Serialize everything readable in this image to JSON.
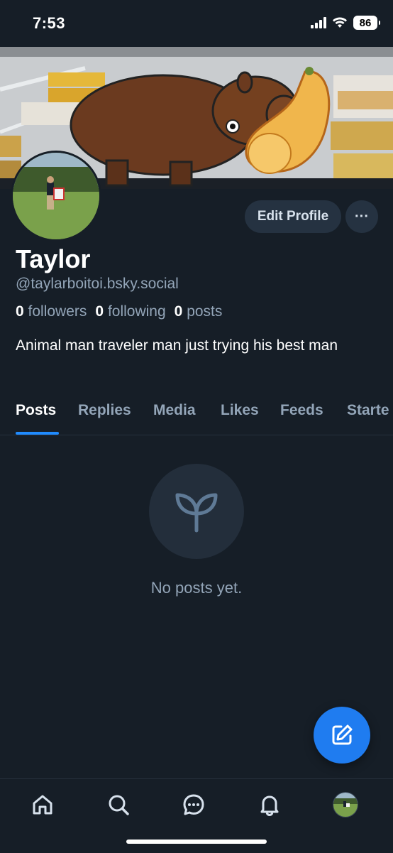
{
  "status_bar": {
    "time": "7:53",
    "battery": "86",
    "icons": [
      "signal-icon",
      "wifi-icon",
      "battery-icon"
    ]
  },
  "profile": {
    "display_name": "Taylor",
    "handle": "@taylarboitoi.bsky.social",
    "followers_count": "0",
    "followers_label": "followers",
    "following_count": "0",
    "following_label": "following",
    "posts_count": "0",
    "posts_label": "posts",
    "bio": "Animal man traveler man just trying his best man",
    "edit_button": "Edit Profile",
    "more_button": "···"
  },
  "tabs": [
    {
      "label": "Posts",
      "active": true
    },
    {
      "label": "Replies",
      "active": false
    },
    {
      "label": "Media",
      "active": false
    },
    {
      "label": "Likes",
      "active": false
    },
    {
      "label": "Feeds",
      "active": false
    },
    {
      "label": "Starte",
      "active": false
    }
  ],
  "feed": {
    "empty_text": "No posts yet.",
    "empty_icon": "seedling-icon"
  },
  "fab": {
    "icon": "compose-icon"
  },
  "bottom_nav": {
    "items": [
      "home-icon",
      "search-icon",
      "chat-icon",
      "bell-icon",
      "profile-avatar"
    ]
  },
  "colors": {
    "background": "#161e27",
    "accent": "#208bfe",
    "muted_text": "#93a5b8",
    "button_bg": "#253241"
  }
}
